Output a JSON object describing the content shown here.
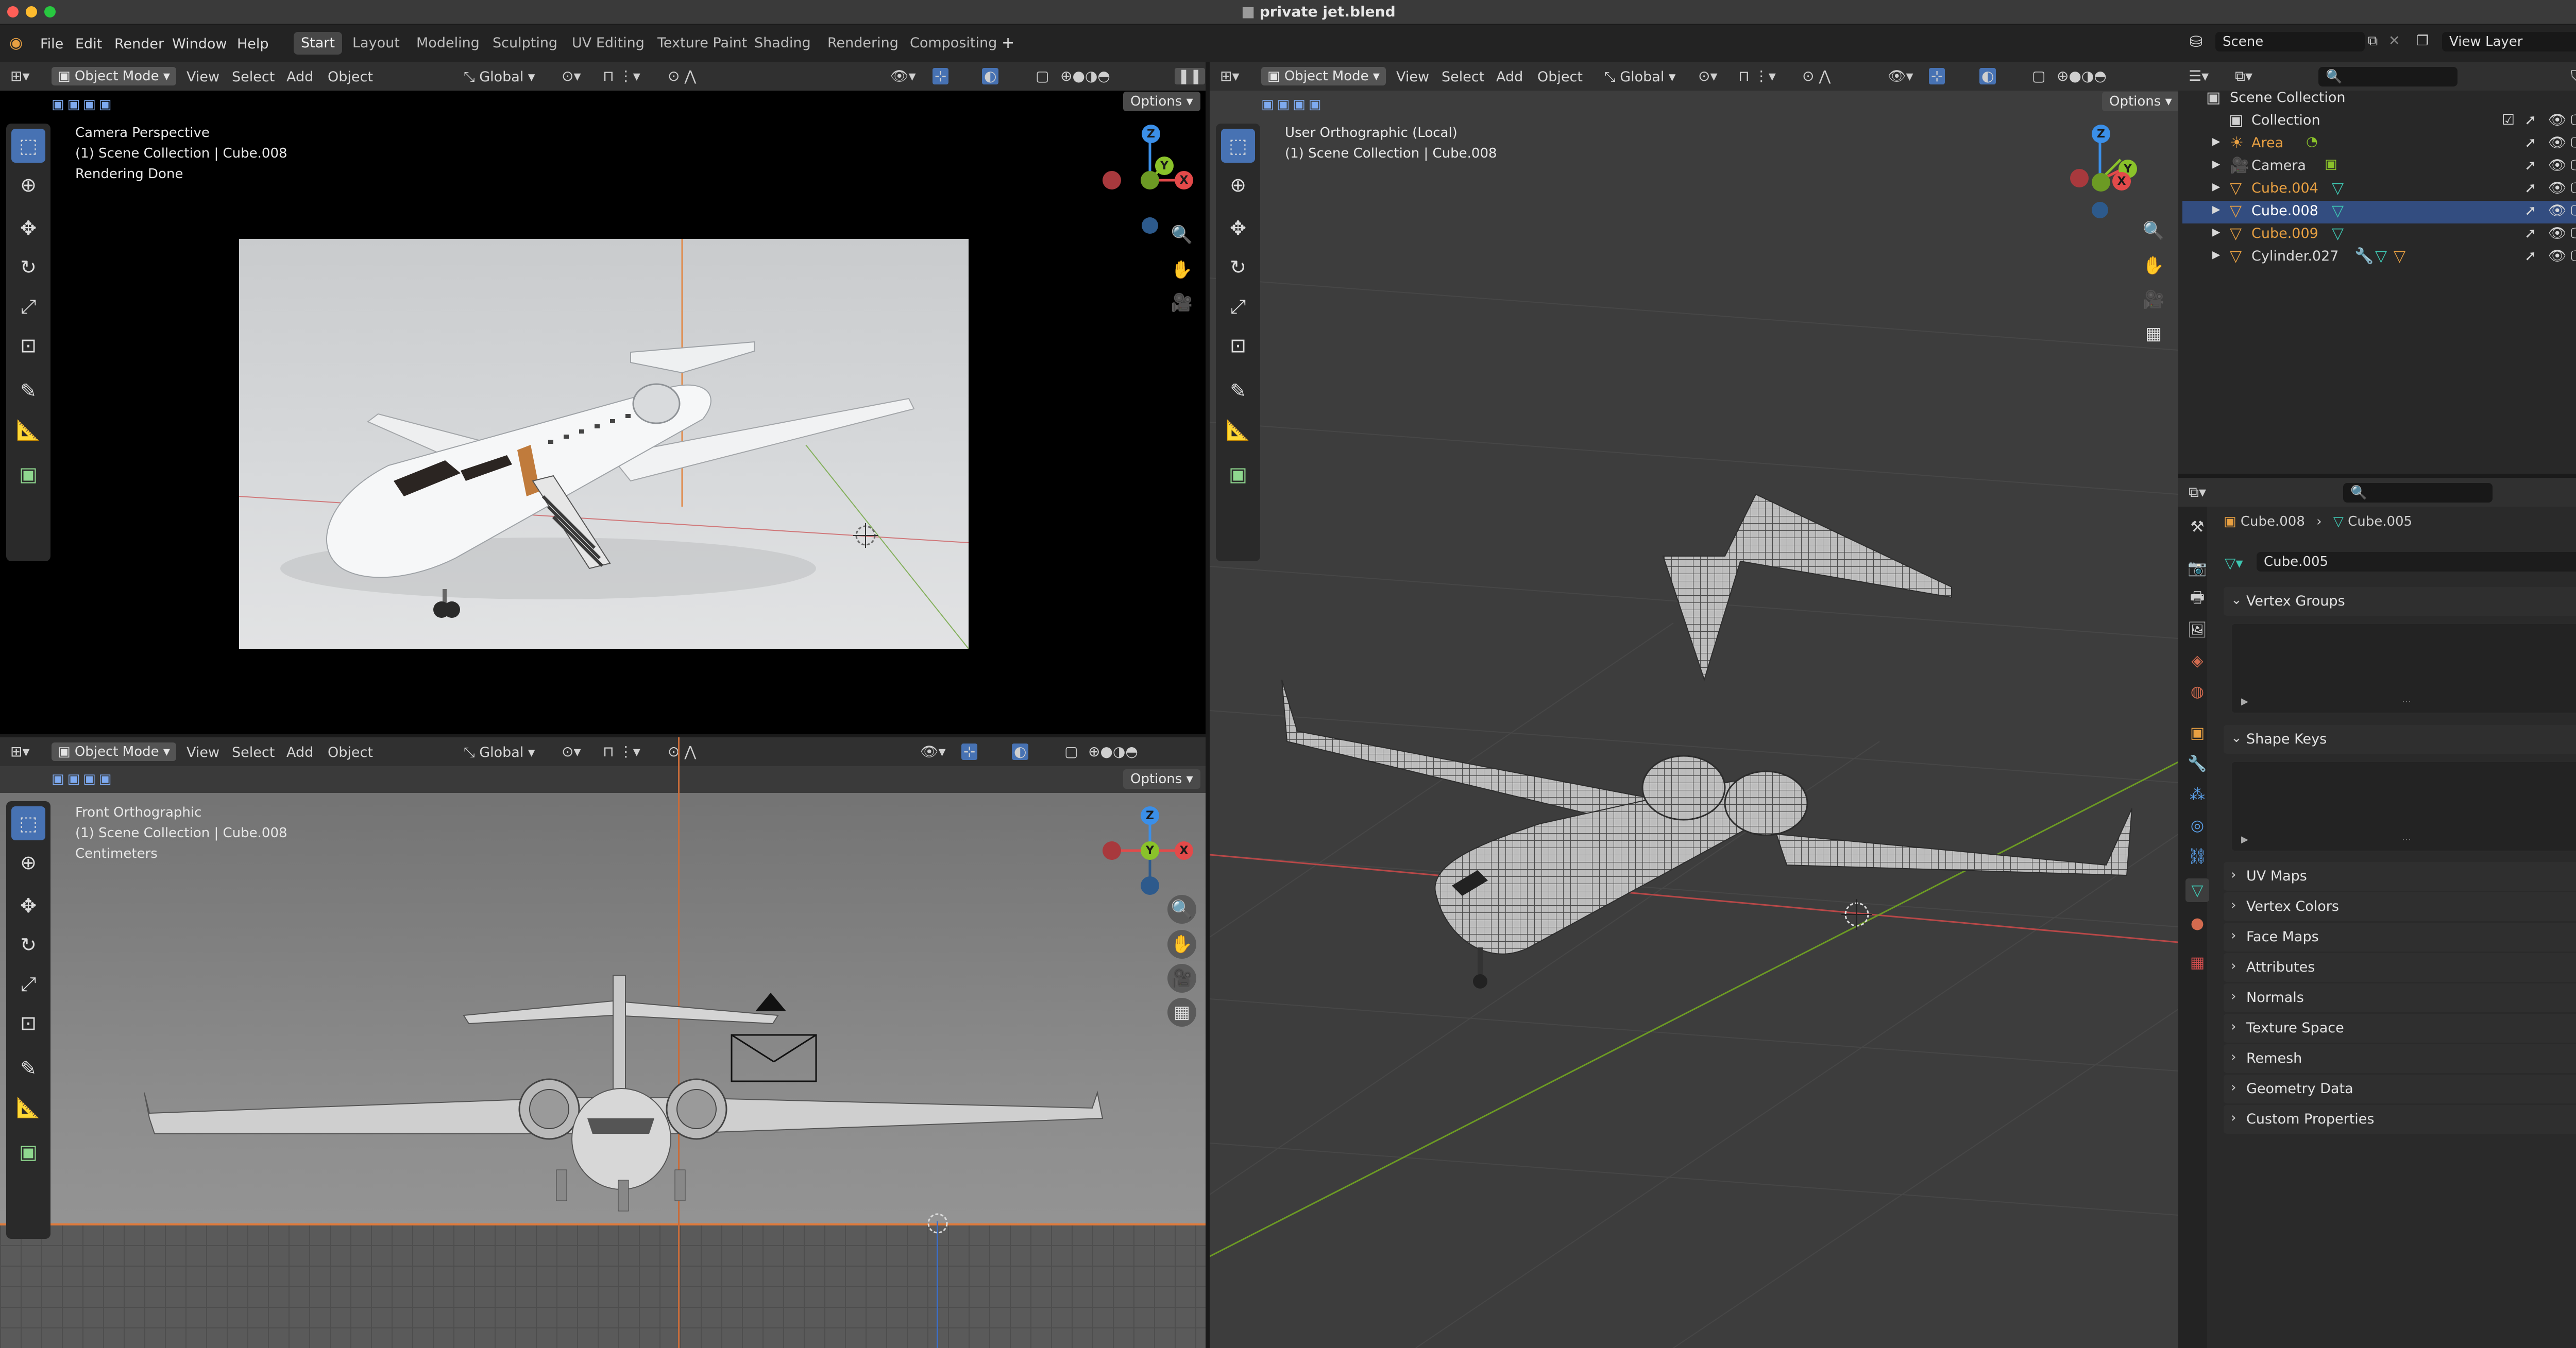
{
  "window_title": "private jet.blend",
  "menu": {
    "items": [
      "File",
      "Edit",
      "Render",
      "Window",
      "Help"
    ]
  },
  "workspaces": [
    "Start",
    "Layout",
    "Modeling",
    "Sculpting",
    "UV Editing",
    "Texture Paint",
    "Shading",
    "Rendering",
    "Compositing"
  ],
  "scene": {
    "name": "Scene",
    "view_layer": "View Layer"
  },
  "viewport_header": {
    "mode": "Object Mode",
    "menus": [
      "View",
      "Select",
      "Add",
      "Object"
    ],
    "orientation": "Global",
    "options": "Options"
  },
  "camera_view": {
    "line1": "Camera Perspective",
    "line2": "(1) Scene Collection | Cube.008",
    "line3": "Rendering Done"
  },
  "front_view": {
    "line1": "Front Orthographic",
    "line2": "(1) Scene Collection | Cube.008",
    "line3": "Centimeters"
  },
  "user_view": {
    "line1": "User Orthographic (Local)",
    "line2": "(1) Scene Collection | Cube.008"
  },
  "gizmo": {
    "x": "X",
    "y": "Y",
    "z": "Z"
  },
  "outliner": {
    "root": "Scene Collection",
    "collection": "Collection",
    "items": [
      {
        "name": "Area",
        "color": "#e8a042"
      },
      {
        "name": "Camera",
        "color": "#d9d9d9"
      },
      {
        "name": "Cube.004",
        "color": "#e8a042"
      },
      {
        "name": "Cube.008",
        "color": "#ffffff",
        "selected": true
      },
      {
        "name": "Cube.009",
        "color": "#e8a042"
      },
      {
        "name": "Cylinder.027",
        "color": "#d9d9d9"
      }
    ]
  },
  "properties": {
    "breadcrumb_object": "Cube.008",
    "breadcrumb_data": "Cube.005",
    "mesh_name": "Cube.005",
    "panels": {
      "vertex_groups": "Vertex Groups",
      "shape_keys": "Shape Keys",
      "collapsed": [
        "UV Maps",
        "Vertex Colors",
        "Face Maps",
        "Attributes",
        "Normals",
        "Texture Space",
        "Remesh",
        "Geometry Data",
        "Custom Properties"
      ]
    }
  },
  "colors": {
    "accent": "#4772b3",
    "x_axis": "#e34a4a",
    "y_axis": "#8ac22a",
    "z_axis": "#3b8fe8",
    "orange": "#e8a042"
  }
}
